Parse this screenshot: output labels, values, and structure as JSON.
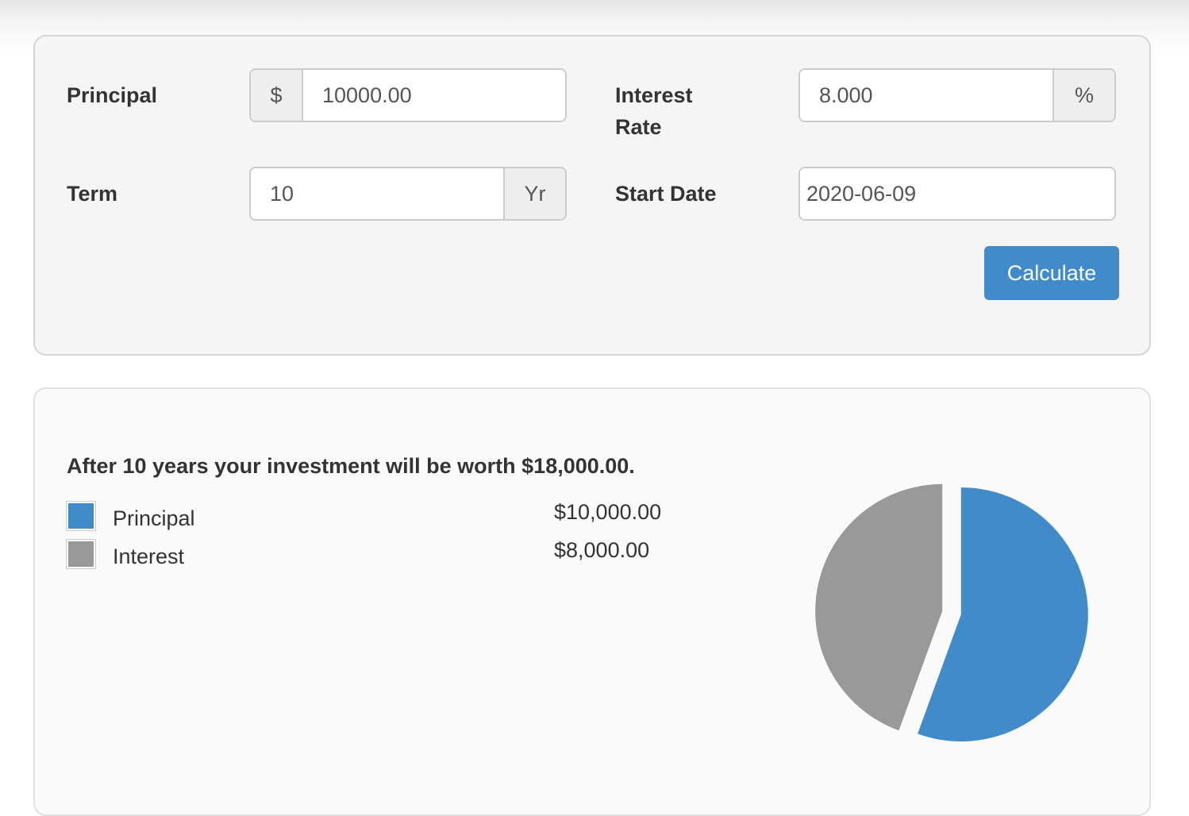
{
  "form": {
    "principal": {
      "label": "Principal",
      "prefix": "$",
      "value": "10000.00"
    },
    "interest_rate": {
      "label_line1": "Interest",
      "label_line2": "Rate",
      "value": "8.000",
      "suffix": "%"
    },
    "term": {
      "label": "Term",
      "value": "10",
      "suffix": "Yr"
    },
    "start_date": {
      "label": "Start Date",
      "value": "2020-06-09"
    },
    "calculate_label": "Calculate"
  },
  "result": {
    "summary": "After 10 years your investment will be worth $18,000.00.",
    "legend": [
      {
        "label": "Principal",
        "value": "$10,000.00",
        "color": "#428bca"
      },
      {
        "label": "Interest",
        "value": "$8,000.00",
        "color": "#999999"
      }
    ]
  },
  "chart_data": {
    "type": "pie",
    "categories": [
      "Principal",
      "Interest"
    ],
    "values": [
      10000,
      8000
    ],
    "colors": [
      "#428bca",
      "#999999"
    ],
    "exploded": true
  }
}
